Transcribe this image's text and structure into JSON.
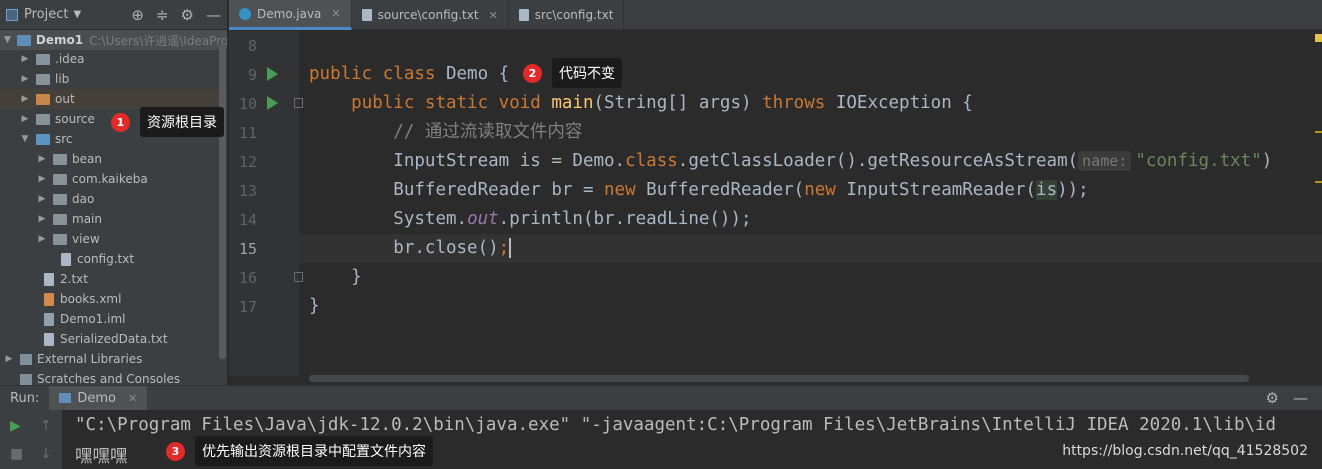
{
  "project_panel": {
    "title": "Project",
    "root": {
      "name": "Demo1",
      "path": "C:\\Users\\许逍遥\\IdeaPro"
    },
    "items": [
      {
        "label": ".idea",
        "kind": "folder"
      },
      {
        "label": "lib",
        "kind": "folder"
      },
      {
        "label": "out",
        "kind": "folder-orange"
      },
      {
        "label": "source",
        "kind": "folder-res"
      },
      {
        "label": "src",
        "kind": "folder-src"
      },
      {
        "label": "bean",
        "kind": "package"
      },
      {
        "label": "com.kaikeba",
        "kind": "package"
      },
      {
        "label": "dao",
        "kind": "package"
      },
      {
        "label": "main",
        "kind": "package"
      },
      {
        "label": "view",
        "kind": "package"
      },
      {
        "label": "config.txt",
        "kind": "file"
      },
      {
        "label": "2.txt",
        "kind": "file"
      },
      {
        "label": "books.xml",
        "kind": "xml"
      },
      {
        "label": "Demo1.iml",
        "kind": "iml"
      },
      {
        "label": "SerializedData.txt",
        "kind": "file"
      },
      {
        "label": "External Libraries",
        "kind": "lib"
      },
      {
        "label": "Scratches and Consoles",
        "kind": "scratch"
      }
    ]
  },
  "tabs": [
    {
      "label": "Demo.java",
      "active": true
    },
    {
      "label": "source\\config.txt",
      "active": false
    },
    {
      "label": "src\\config.txt",
      "active": false
    }
  ],
  "editor": {
    "line_numbers": [
      "8",
      "9",
      "10",
      "11",
      "12",
      "13",
      "14",
      "15",
      "16",
      "17"
    ],
    "current_line": "15",
    "code": {
      "l9_kw": "public class ",
      "l9_name": "Demo {",
      "l10_kw1": "public static void ",
      "l10_fn": "main",
      "l10_params": "(String[] args) ",
      "l10_kw2": "throws ",
      "l10_exc": "IOException {",
      "l11_comment": "// 通过流读取文件内容",
      "l12_a": "InputStream is = Demo.",
      "l12_kw": "class",
      "l12_b": ".getClassLoader().getResourceAsStream(",
      "l12_hint": "name:",
      "l12_str": "\"config.txt\"",
      "l12_end": ")",
      "l13_a": "BufferedReader br = ",
      "l13_kw1": "new ",
      "l13_b": "BufferedReader(",
      "l13_kw2": "new ",
      "l13_c": "InputStreamReader(",
      "l13_var": "is",
      "l13_end": "));",
      "l14_a": "System.",
      "l14_field": "out",
      "l14_b": ".println(br.readLine());",
      "l15_a": "br.close()",
      "l15_semi": ";",
      "l16": "}",
      "l17": "}"
    }
  },
  "callouts": [
    {
      "number": "1",
      "text": "资源根目录"
    },
    {
      "number": "2",
      "text": "代码不变"
    },
    {
      "number": "3",
      "text": "优先输出资源根目录中配置文件内容"
    }
  ],
  "run_panel": {
    "label": "Run:",
    "tab": "Demo",
    "output": [
      "\"C:\\Program Files\\Java\\jdk-12.0.2\\bin\\java.exe\" \"-javaagent:C:\\Program Files\\JetBrains\\IntelliJ IDEA 2020.1\\lib\\id",
      "嘿嘿嘿"
    ]
  },
  "watermark": "https://blog.csdn.net/qq_41528502",
  "colors": {
    "keyword": "#cc7832",
    "method": "#ffc66d",
    "comment": "#808080",
    "string": "#6a8759",
    "badge": "#e22a2a"
  }
}
